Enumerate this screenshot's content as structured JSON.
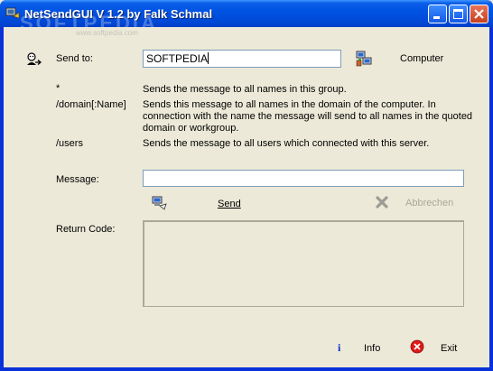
{
  "window": {
    "title": "NetSendGUI V 1.2 by Falk Schmal",
    "watermark": "SOFTPEDIA",
    "watermark_url": "www.softpedia.com"
  },
  "sendto": {
    "label": "Send to:",
    "value": "SOFTPEDIA",
    "computer_button": "Computer"
  },
  "help": [
    {
      "key": "*",
      "text": "Sends the message to all names in this group."
    },
    {
      "key": "/domain[:Name]",
      "line1": "Sends this message to all names in the domain of the computer. In",
      "line2": "connection with the name the message will send to all names in the quoted",
      "line3": "domain or workgroup."
    },
    {
      "key": "/users",
      "text": "Sends the message to all users which connected with this server."
    }
  ],
  "message": {
    "label": "Message:",
    "value": ""
  },
  "actions": {
    "send": "Send",
    "cancel": "Abbrechen"
  },
  "return_code": {
    "label": "Return Code:"
  },
  "footer": {
    "info": "Info",
    "exit": "Exit"
  }
}
